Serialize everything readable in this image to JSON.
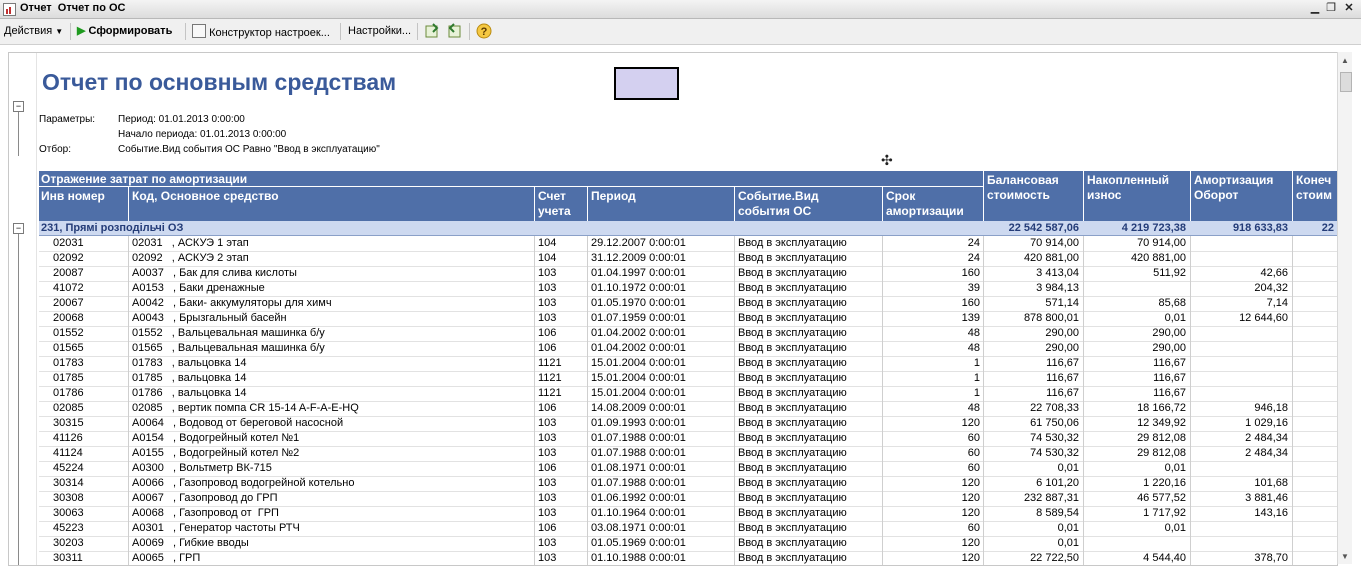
{
  "window": {
    "title": "Отчет  Отчет по ОС",
    "minimize_icon": "minimize-icon",
    "restore_icon": "restore-icon",
    "close_icon": "close-icon"
  },
  "toolbar": {
    "actions_label": "Действия",
    "generate_label": "Сформировать",
    "constructor_label": "Конструктор настроек...",
    "settings_label": "Настройки..."
  },
  "report": {
    "title": "Отчет по основным средствам",
    "params_label": "Параметры:",
    "period": "Период: 01.01.2013 0:00:00",
    "period_start": "Начало периода: 01.01.2013 0:00:00",
    "filter_label": "Отбор:",
    "filter_value": "Событие.Вид события ОС Равно \"Ввод в эксплуатацию\""
  },
  "table": {
    "group_header": "Отражение затрат по амортизации",
    "col_inv": "Инв номер",
    "col_code": "Код, Основное средство",
    "col_account": "Счет\nучета",
    "col_period": "Период",
    "col_event": "Событие.Вид\nсобытия ОС",
    "col_term": "Срок\nамортизации",
    "col_balance": "Балансовая\nстоимость",
    "col_accum": "Накопленный\nизнос",
    "col_amort": "Амортизация\nОборот",
    "col_final": "Конеч\nстоим",
    "group": {
      "label": "231, Прямі розподільчі ОЗ",
      "balance": "22 542 587,06",
      "accum": "4 219 723,38",
      "amort": "918 633,83",
      "final": "22"
    },
    "rows": [
      {
        "inv": "02031",
        "code": "02031   , АСКУЭ 1 этап",
        "acc": "104",
        "period": "29.12.2007 0:00:01",
        "event": "Ввод в эксплуатацию",
        "term": "24",
        "bal": "70 914,00",
        "acc_iznos": "70 914,00",
        "amort": ""
      },
      {
        "inv": "02092",
        "code": "02092   , АСКУЭ 2 этап",
        "acc": "104",
        "period": "31.12.2009 0:00:01",
        "event": "Ввод в эксплуатацию",
        "term": "24",
        "bal": "420 881,00",
        "acc_iznos": "420 881,00",
        "amort": ""
      },
      {
        "inv": "20087",
        "code": "А0037   , Бак для слива кислоты",
        "acc": "103",
        "period": "01.04.1997 0:00:01",
        "event": "Ввод в эксплуатацию",
        "term": "160",
        "bal": "3 413,04",
        "acc_iznos": "511,92",
        "amort": "42,66"
      },
      {
        "inv": "41072",
        "code": "А0153   , Баки дренажные",
        "acc": "103",
        "period": "01.10.1972 0:00:01",
        "event": "Ввод в эксплуатацию",
        "term": "39",
        "bal": "3 984,13",
        "acc_iznos": "",
        "amort": "204,32"
      },
      {
        "inv": "20067",
        "code": "А0042   , Баки- аккумуляторы для химч",
        "acc": "103",
        "period": "01.05.1970 0:00:01",
        "event": "Ввод в эксплуатацию",
        "term": "160",
        "bal": "571,14",
        "acc_iznos": "85,68",
        "amort": "7,14"
      },
      {
        "inv": "20068",
        "code": "А0043   , Брызгальный басейн",
        "acc": "103",
        "period": "01.07.1959 0:00:01",
        "event": "Ввод в эксплуатацию",
        "term": "139",
        "bal": "878 800,01",
        "acc_iznos": "0,01",
        "amort": "12 644,60"
      },
      {
        "inv": "01552",
        "code": "01552   , Вальцевальная машинка б/у",
        "acc": "106",
        "period": "01.04.2002 0:00:01",
        "event": "Ввод в эксплуатацию",
        "term": "48",
        "bal": "290,00",
        "acc_iznos": "290,00",
        "amort": ""
      },
      {
        "inv": "01565",
        "code": "01565   , Вальцевальная машинка б/у",
        "acc": "106",
        "period": "01.04.2002 0:00:01",
        "event": "Ввод в эксплуатацию",
        "term": "48",
        "bal": "290,00",
        "acc_iznos": "290,00",
        "amort": ""
      },
      {
        "inv": "01783",
        "code": "01783   , вальцовка 14",
        "acc": "1121",
        "period": "15.01.2004 0:00:01",
        "event": "Ввод в эксплуатацию",
        "term": "1",
        "bal": "116,67",
        "acc_iznos": "116,67",
        "amort": ""
      },
      {
        "inv": "01785",
        "code": "01785   , вальцовка 14",
        "acc": "1121",
        "period": "15.01.2004 0:00:01",
        "event": "Ввод в эксплуатацию",
        "term": "1",
        "bal": "116,67",
        "acc_iznos": "116,67",
        "amort": ""
      },
      {
        "inv": "01786",
        "code": "01786   , вальцовка 14",
        "acc": "1121",
        "period": "15.01.2004 0:00:01",
        "event": "Ввод в эксплуатацию",
        "term": "1",
        "bal": "116,67",
        "acc_iznos": "116,67",
        "amort": ""
      },
      {
        "inv": "02085",
        "code": "02085   , вертик помпа CR 15-14 A-F-A-E-HQ",
        "acc": "106",
        "period": "14.08.2009 0:00:01",
        "event": "Ввод в эксплуатацию",
        "term": "48",
        "bal": "22 708,33",
        "acc_iznos": "18 166,72",
        "amort": "946,18"
      },
      {
        "inv": "30315",
        "code": "А0064   , Водовод от береговой насосной",
        "acc": "103",
        "period": "01.09.1993 0:00:01",
        "event": "Ввод в эксплуатацию",
        "term": "120",
        "bal": "61 750,06",
        "acc_iznos": "12 349,92",
        "amort": "1 029,16"
      },
      {
        "inv": "41126",
        "code": "А0154   , Водогрейный котел №1",
        "acc": "103",
        "period": "01.07.1988 0:00:01",
        "event": "Ввод в эксплуатацию",
        "term": "60",
        "bal": "74 530,32",
        "acc_iznos": "29 812,08",
        "amort": "2 484,34"
      },
      {
        "inv": "41124",
        "code": "А0155   , Водогрейный котел №2",
        "acc": "103",
        "period": "01.07.1988 0:00:01",
        "event": "Ввод в эксплуатацию",
        "term": "60",
        "bal": "74 530,32",
        "acc_iznos": "29 812,08",
        "amort": "2 484,34"
      },
      {
        "inv": "45224",
        "code": "А0300   , Вольтметр ВК-715",
        "acc": "106",
        "period": "01.08.1971 0:00:01",
        "event": "Ввод в эксплуатацию",
        "term": "60",
        "bal": "0,01",
        "acc_iznos": "0,01",
        "amort": ""
      },
      {
        "inv": "30314",
        "code": "А0066   , Газопровод водогрейной котельно",
        "acc": "103",
        "period": "01.07.1988 0:00:01",
        "event": "Ввод в эксплуатацию",
        "term": "120",
        "bal": "6 101,20",
        "acc_iznos": "1 220,16",
        "amort": "101,68"
      },
      {
        "inv": "30308",
        "code": "А0067   , Газопровод до ГРП",
        "acc": "103",
        "period": "01.06.1992 0:00:01",
        "event": "Ввод в эксплуатацию",
        "term": "120",
        "bal": "232 887,31",
        "acc_iznos": "46 577,52",
        "amort": "3 881,46"
      },
      {
        "inv": "30063",
        "code": "А0068   , Газопровод от  ГРП",
        "acc": "103",
        "period": "01.10.1964 0:00:01",
        "event": "Ввод в эксплуатацию",
        "term": "120",
        "bal": "8 589,54",
        "acc_iznos": "1 717,92",
        "amort": "143,16"
      },
      {
        "inv": "45223",
        "code": "А0301   , Генератор частоты РТЧ",
        "acc": "106",
        "period": "03.08.1971 0:00:01",
        "event": "Ввод в эксплуатацию",
        "term": "60",
        "bal": "0,01",
        "acc_iznos": "0,01",
        "amort": ""
      },
      {
        "inv": "30203",
        "code": "А0069   , Гибкие вводы",
        "acc": "103",
        "period": "01.05.1969 0:00:01",
        "event": "Ввод в эксплуатацию",
        "term": "120",
        "bal": "0,01",
        "acc_iznos": "",
        "amort": ""
      },
      {
        "inv": "30311",
        "code": "А0065   , ГРП",
        "acc": "103",
        "period": "01.10.1988 0:00:01",
        "event": "Ввод в эксплуатацию",
        "term": "120",
        "bal": "22 722,50",
        "acc_iznos": "4 544,40",
        "amort": "378,70"
      }
    ]
  }
}
